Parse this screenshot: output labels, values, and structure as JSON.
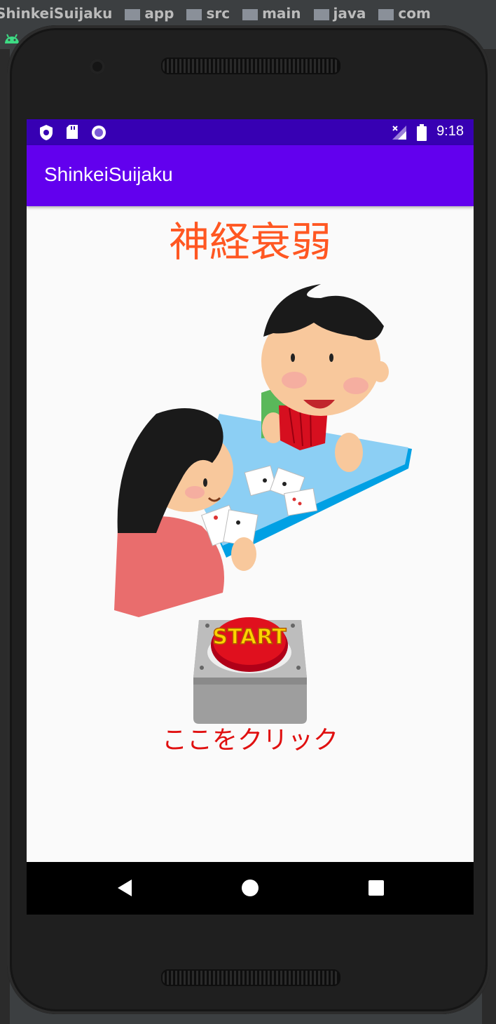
{
  "ide": {
    "breadcrumb": [
      "ShinkeiSuijaku",
      "app",
      "src",
      "main",
      "java",
      "com"
    ]
  },
  "status_bar": {
    "time": "9:18",
    "icons": [
      "shield-icon",
      "sd-card-icon",
      "circle-icon",
      "signal-icon",
      "battery-icon"
    ]
  },
  "app_bar": {
    "title": "ShinkeiSuijaku"
  },
  "main": {
    "game_title": "神経衰弱",
    "start_label": "START",
    "click_text": "ここをクリック"
  },
  "nav_bar": {
    "icons": [
      "back-icon",
      "home-icon",
      "recents-icon"
    ]
  },
  "colors": {
    "status_bar": "#3700b3",
    "app_bar": "#6200ee",
    "title_text": "#ff5722",
    "click_text": "#e01010"
  }
}
